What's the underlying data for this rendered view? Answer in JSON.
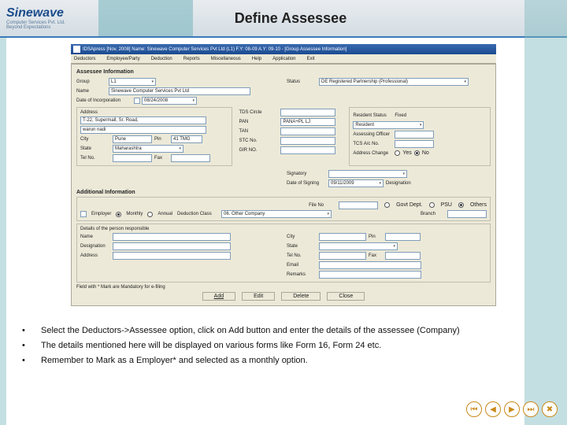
{
  "logo": {
    "main": "Sinewave",
    "sub1": "Computer Services Pvt. Ltd.",
    "sub2": "Beyond Expectations"
  },
  "header": {
    "title": "Define Assessee"
  },
  "titlebar": "IDSApress [Nov, 2008] Name: Sinewave Computer Services Pvt Ltd (L1)  F.Y: 08-09  A.Y: 09-10 - [Group Assessee Information]",
  "menu": [
    "Deductors",
    "Employee/Party",
    "Deduction",
    "Reports",
    "Miscellaneous",
    "Help",
    "Application",
    "Exit"
  ],
  "sec": {
    "info": "Assessee Information",
    "addr": "Address",
    "addl": "Additional Information",
    "resp": "Details of the person responsible"
  },
  "labels": {
    "group": "Group",
    "name": "Name",
    "dateinc": "Date of Incorporation",
    "status": "Status",
    "city": "City",
    "pin": "Pin",
    "state": "State",
    "tel": "Tel No.",
    "fax": "Fax",
    "tds": "TDS Circle",
    "pan": "PAN",
    "tan": "TAN",
    "stc": "STC No.",
    "gir": "GIR NO.",
    "resstat": "Resident Status",
    "fixed": "Fixed",
    "assoff": "Assessing Officer",
    "tcsacno": "TCS A/c No.",
    "addrchg": "Address Change",
    "signatory": "Signatory",
    "dos": "Date of Signing",
    "designation": "Designation",
    "fileno": "File No",
    "govtdept": "Govt Dept.",
    "psu": "PSU",
    "others": "Others",
    "employer": "Employer",
    "monthly": "Monthly",
    "annual": "Annual",
    "dedclass": "Deduction Class",
    "branch": "Branch",
    "desig": "Designation",
    "email": "Email",
    "remarks": "Remarks",
    "yes": "Yes",
    "no": "No"
  },
  "values": {
    "group": "L1",
    "name": "Sinewave Computer Services Pvt Ltd",
    "dateinc": "08/24/2008",
    "status": "DE Registered Partnership (Professional)",
    "addr1": "T-22, Supermall, Sr. Road,",
    "addr2": "warun nadi",
    "city": "Pune",
    "pin": "41 TMG",
    "state": "Maharashtra",
    "pan": "PANA+PL LJ",
    "resstat": "Resident",
    "dos": "09/11/2009",
    "dedclass": "06. Other Company"
  },
  "buttons": {
    "add": "Add",
    "edit": "Edit",
    "delete": "Delete",
    "close": "Close"
  },
  "footnote": "Field with * Mark are Mandatory for e-filing",
  "bullets": [
    "Select the Deductors->Assessee option, click on Add button and enter the details of the assessee (Company)",
    "The details mentioned here will be displayed on various forms like Form 16, Form 24 etc.",
    "Remember to Mark as a Employer* and selected as a monthly option."
  ],
  "nav": {
    "first": "⏮",
    "prev": "◀",
    "next": "▶",
    "last": "⏭",
    "close": "✖"
  }
}
